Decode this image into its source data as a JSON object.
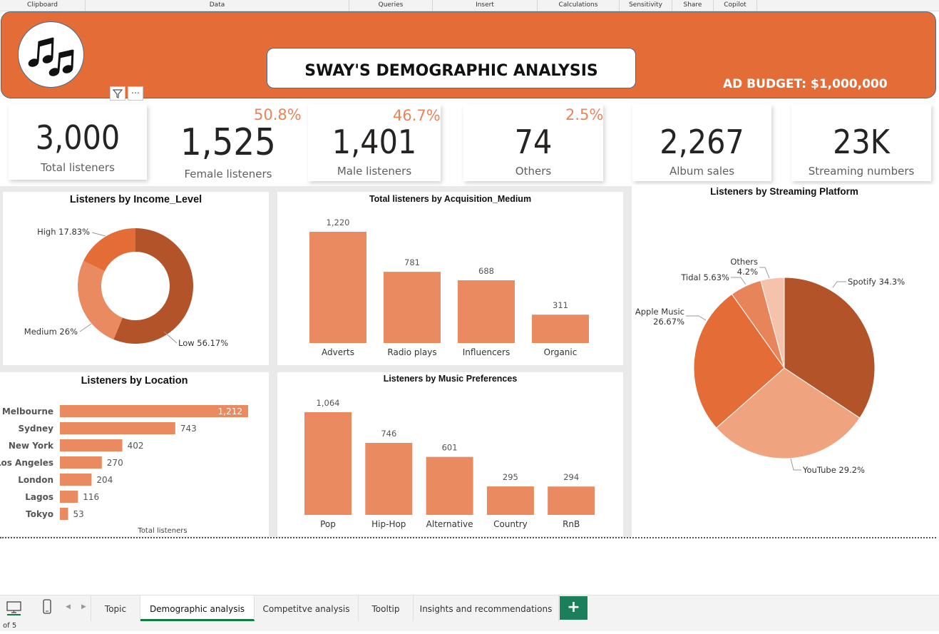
{
  "ribbon": {
    "groups": [
      "Clipboard",
      "Data",
      "Queries",
      "Insert",
      "Calculations",
      "Sensitivity",
      "Share",
      "Copilot"
    ]
  },
  "header": {
    "title": "SWAY'S DEMOGRAPHIC ANALYSIS",
    "budget": "AD BUDGET: $1,000,000",
    "logo_icon": "music-notes-icon",
    "colors": {
      "accent": "#e46c37"
    }
  },
  "visual_header": {
    "filter_icon": "filter-icon",
    "more": "⋯"
  },
  "kpis": {
    "total": {
      "value": "3,000",
      "label": "Total listeners"
    },
    "female": {
      "value": "1,525",
      "label": "Female listeners",
      "pct": "50.8%"
    },
    "male": {
      "value": "1,401",
      "label": "Male listeners",
      "pct": "46.7%"
    },
    "others": {
      "value": "74",
      "label": "Others",
      "pct": "2.5%"
    },
    "album": {
      "value": "2,267",
      "label": "Album sales"
    },
    "stream": {
      "value": "23K",
      "label": "Streaming numbers"
    }
  },
  "chart_data": [
    {
      "type": "pie",
      "title": "Listeners by Income_Level",
      "donut": true,
      "labels": [
        "Low",
        "Medium",
        "High"
      ],
      "display_labels": [
        "Low 56.17%",
        "Medium 26%",
        "High 17.83%"
      ],
      "values": [
        56.17,
        26,
        17.83
      ],
      "colors": [
        "#b3532a",
        "#ea8a60",
        "#e46c37"
      ]
    },
    {
      "type": "bar",
      "title": "Total listeners by Acquisition_Medium",
      "categories": [
        "Adverts",
        "Radio plays",
        "Influencers",
        "Organic"
      ],
      "values": [
        1220,
        781,
        688,
        311
      ],
      "value_labels": [
        "1,220",
        "781",
        "688",
        "311"
      ],
      "ylim": [
        0,
        1220
      ],
      "color": "#ea8a60"
    },
    {
      "type": "bar",
      "orientation": "horizontal",
      "title": "Listeners by Location",
      "xlabel": "Total listeners",
      "categories": [
        "Melbourne",
        "Sydney",
        "New York",
        "Los Angeles",
        "London",
        "Lagos",
        "Tokyo"
      ],
      "values": [
        1212,
        743,
        402,
        270,
        204,
        116,
        53
      ],
      "value_labels": [
        "1,212",
        "743",
        "402",
        "270",
        "204",
        "116",
        "53"
      ],
      "xlim": [
        0,
        1212
      ],
      "color": "#ea8a60"
    },
    {
      "type": "bar",
      "title": "Listeners by Music Preferences",
      "categories": [
        "Pop",
        "Hip-Hop",
        "Alternative",
        "Country",
        "RnB"
      ],
      "values": [
        1064,
        746,
        601,
        295,
        294
      ],
      "value_labels": [
        "1,064",
        "746",
        "601",
        "295",
        "294"
      ],
      "ylim": [
        0,
        1064
      ],
      "color": "#ea8a60"
    },
    {
      "type": "pie",
      "title": "Listeners by Streaming Platform",
      "labels": [
        "Spotify",
        "YouTube",
        "Apple Music",
        "Tidal",
        "Others"
      ],
      "values": [
        34.3,
        29.2,
        26.67,
        5.63,
        4.2
      ],
      "colors": [
        "#b3532a",
        "#f0a37f",
        "#e46c37",
        "#e8845a",
        "#f5c3ac"
      ]
    }
  ],
  "tabs": {
    "pages": [
      "Topic",
      "Demographic analysis",
      "Competitve analysis",
      "Tooltip",
      "Insights and recommendations"
    ],
    "active": "Demographic analysis",
    "add_label": "+"
  },
  "status": {
    "page": "of 5"
  }
}
